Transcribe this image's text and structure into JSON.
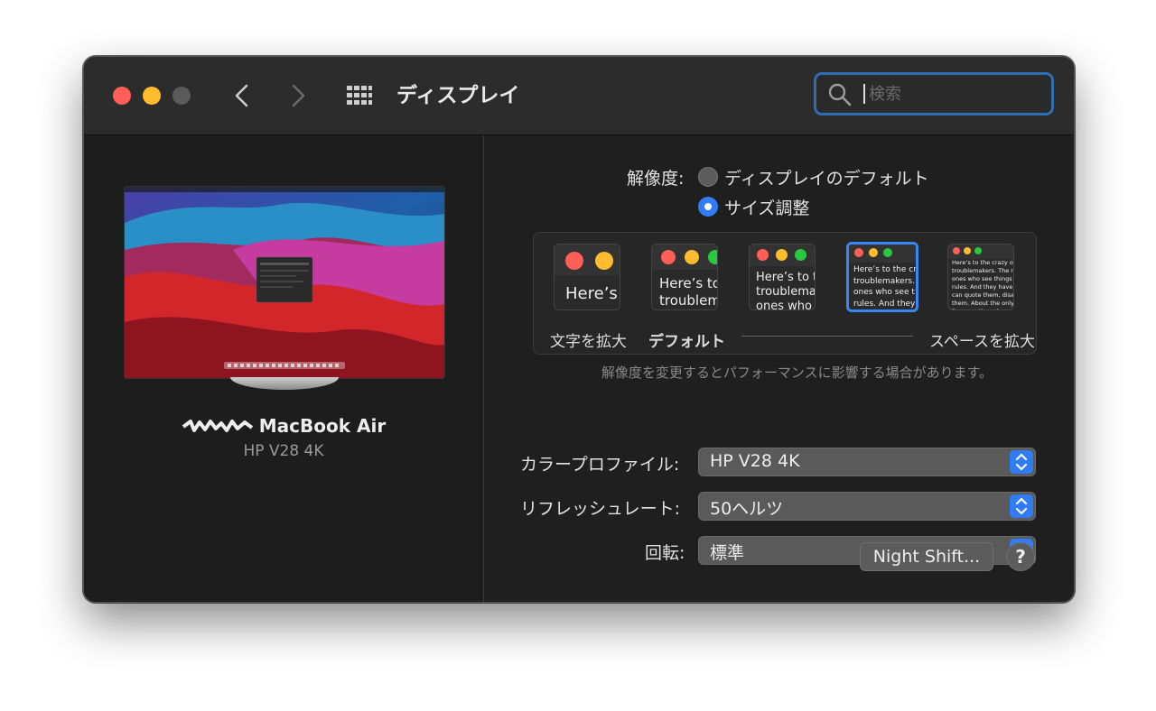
{
  "window": {
    "title": "ディスプレイ"
  },
  "search": {
    "placeholder": "検索"
  },
  "device": {
    "name": "MacBook Air",
    "model": "HP V28 4K"
  },
  "resolution": {
    "label": "解像度:",
    "options": [
      {
        "label": "ディスプレイのデフォルト",
        "selected": false
      },
      {
        "label": "サイズ調整",
        "selected": true
      }
    ],
    "scale_options": [
      {
        "sample": "Here’s",
        "selected": false
      },
      {
        "sample": "Here’s to\ntroublem",
        "selected": false
      },
      {
        "sample": "Here’s to t\ntroublema\nones who",
        "selected": false
      },
      {
        "sample": "Here’s to the cr\ntroublemakers.\nones who see t\nrules. And they",
        "selected": true
      },
      {
        "sample": "Here’s to the crazy one\ntroublemakers. The rou\nones who see things dif\nrules. And they have no\ncan quote them, disagre\nthem. About the only th\nBecause they change th",
        "selected": false
      }
    ],
    "left_caption": "文字を拡大",
    "default_caption": "デフォルト",
    "right_caption": "スペースを拡大",
    "note": "解像度を変更するとパフォーマンスに影響する場合があります。"
  },
  "color_profile": {
    "label": "カラープロファイル:",
    "value": "HP V28 4K"
  },
  "refresh_rate": {
    "label": "リフレッシュレート:",
    "value": "50ヘルツ"
  },
  "rotation": {
    "label": "回転:",
    "value": "標準"
  },
  "buttons": {
    "night_shift": "Night Shift...",
    "help": "?"
  },
  "colors": {
    "accent": "#2f7cf6",
    "search_border": "#2e6fb3",
    "close": "#fe5f57",
    "minimize": "#febc2e",
    "zoom": "#28c840"
  }
}
